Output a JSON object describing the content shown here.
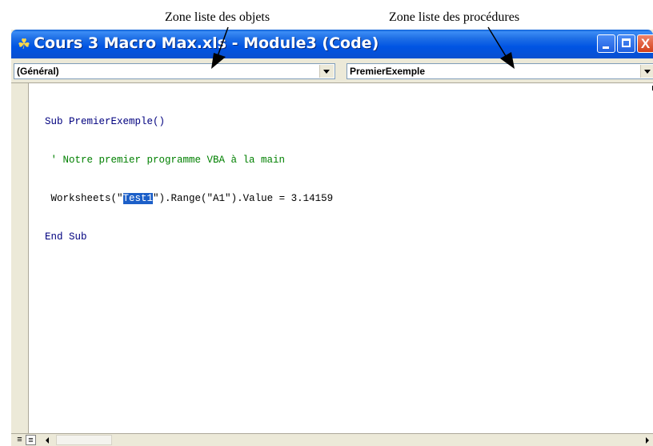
{
  "annotations": {
    "objects_label": "Zone liste des objets",
    "procedures_label": "Zone liste des procédures"
  },
  "window": {
    "title": "Cours 3 Macro Max.xls - Module3 (Code)",
    "close_glyph": "X"
  },
  "combos": {
    "objects_value": "(Général)",
    "procedures_value": "PremierExemple"
  },
  "code": {
    "line1": "Sub PremierExemple()",
    "line2": " ' Notre premier programme VBA à la main",
    "line3_before": " Worksheets(\"",
    "line3_selected": "Test1",
    "line3_after": "\").Range(\"A1\").Value = 3.14159",
    "line4": "End Sub"
  },
  "colors": {
    "titlebar": "#0054e3",
    "keyword": "#00007f",
    "comment": "#008000",
    "selection": "#1c5fc8"
  },
  "icons": [
    "vba-module-icon",
    "minimize-icon",
    "maximize-icon",
    "close-icon",
    "chevron-down-icon",
    "procedure-view-icon",
    "full-module-view-icon",
    "scroll-left-icon",
    "scroll-right-icon"
  ]
}
